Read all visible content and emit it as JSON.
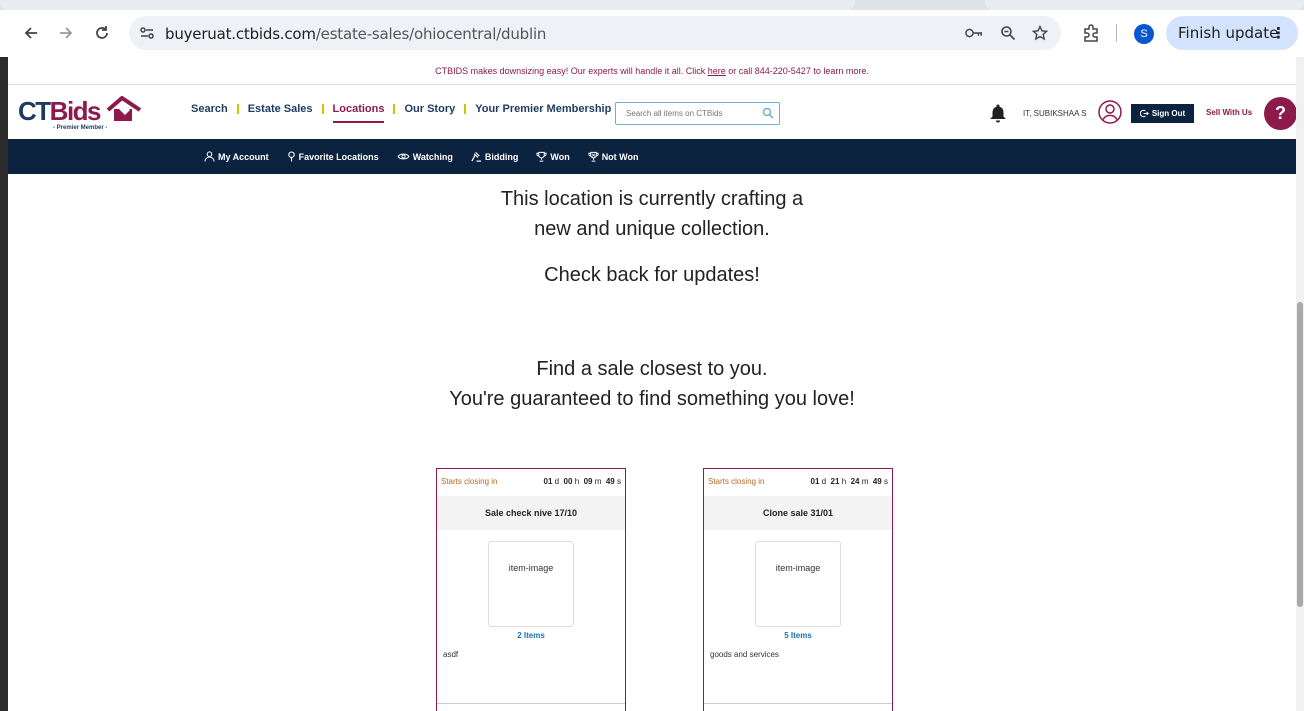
{
  "browser": {
    "url_host": "buyeruat.ctbids.com",
    "url_path": "/estate-sales/ohiocentral/dublin",
    "profile_initial": "S",
    "finish_update_label": "Finish update"
  },
  "promo": {
    "text_before": "CTBIDS makes downsizing easy! Our experts will handle it all. Click ",
    "link": "here",
    "text_after": " or call 844-220-5427 to learn more."
  },
  "logo": {
    "member_text": "- Premier Member -"
  },
  "nav": {
    "items": [
      "Search",
      "Estate Sales",
      "Locations",
      "Our Story",
      "Your Premier Membership"
    ]
  },
  "search": {
    "placeholder": "Search all items on CTBids"
  },
  "user": {
    "name": "IT, SUBIKSHAA S",
    "sign_out": "Sign Out",
    "sell": "Sell With Us",
    "help": "?"
  },
  "subnav": {
    "items": [
      "My Account",
      "Favorite Locations",
      "Watching",
      "Bidding",
      "Won",
      "Not Won"
    ]
  },
  "messages": {
    "line1": "This location is currently crafting a",
    "line2": "new and unique collection.",
    "line3": "Check back for updates!",
    "line4": "Find a sale closest to you.",
    "line5": "You're guaranteed to find something you love!"
  },
  "cards": [
    {
      "closing_label": "Starts closing in",
      "d": "01",
      "h": "00",
      "m": "09",
      "s": "49",
      "title": "Sale check nive 17/10",
      "img_alt": "item-image",
      "items": "2 Items",
      "desc": "asdf"
    },
    {
      "closing_label": "Starts closing in",
      "d": "01",
      "h": "21",
      "m": "24",
      "s": "49",
      "title": "Clone sale 31/01",
      "img_alt": "item-image",
      "items": "5 Items",
      "desc": "goods and services"
    }
  ],
  "units": {
    "d": "d",
    "h": "h",
    "m": "m",
    "s": "s"
  }
}
